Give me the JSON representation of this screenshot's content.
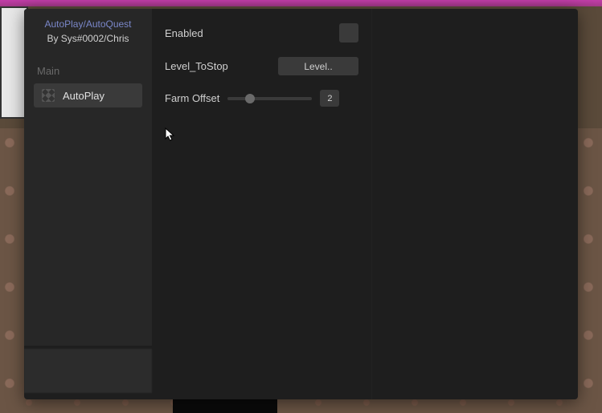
{
  "header": {
    "title": "AutoPlay/AutoQuest",
    "subtitle": "By Sys#0002/Chris"
  },
  "sidebar": {
    "section_label": "Main",
    "items": [
      {
        "label": "AutoPlay",
        "icon": "grid-icon"
      }
    ]
  },
  "settings": {
    "enabled": {
      "label": "Enabled",
      "value": false
    },
    "level_to_stop": {
      "label": "Level_ToStop",
      "selected": "Level.."
    },
    "farm_offset": {
      "label": "Farm Offset",
      "value": 2,
      "min": 0,
      "max": 10
    }
  }
}
